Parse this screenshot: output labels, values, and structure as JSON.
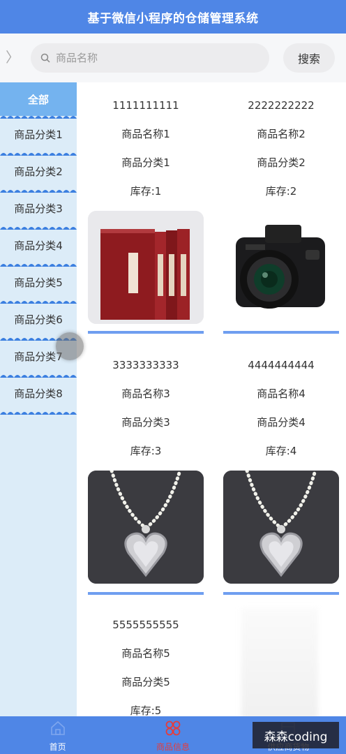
{
  "app": {
    "title": "基于微信小程序的仓储管理系统"
  },
  "search": {
    "placeholder": "商品名称",
    "button_label": "搜索"
  },
  "sidebar": {
    "items": [
      {
        "label": "全部",
        "active": true
      },
      {
        "label": "商品分类1"
      },
      {
        "label": "商品分类2"
      },
      {
        "label": "商品分类3"
      },
      {
        "label": "商品分类4"
      },
      {
        "label": "商品分类5"
      },
      {
        "label": "商品分类6"
      },
      {
        "label": "商品分类7"
      },
      {
        "label": "商品分类8"
      }
    ]
  },
  "products": [
    {
      "code": "1111111111",
      "name": "商品名称1",
      "category": "商品分类1",
      "stock": "库存:1",
      "image": "red-book-set"
    },
    {
      "code": "2222222222",
      "name": "商品名称2",
      "category": "商品分类2",
      "stock": "库存:2",
      "image": "camera"
    },
    {
      "code": "3333333333",
      "name": "商品名称3",
      "category": "商品分类3",
      "stock": "库存:3",
      "image": "heart-necklace"
    },
    {
      "code": "4444444444",
      "name": "商品名称4",
      "category": "商品分类4",
      "stock": "库存:4",
      "image": "heart-necklace"
    },
    {
      "code": "5555555555",
      "name": "商品名称5",
      "category": "商品分类5",
      "stock": "库存:5",
      "image": "none"
    }
  ],
  "tabbar": {
    "items": [
      {
        "label": "首页",
        "icon": "home-icon"
      },
      {
        "label": "商品信息",
        "icon": "goods-icon",
        "active": true
      },
      {
        "label": "供应商货物",
        "icon": "supplier-icon"
      }
    ]
  },
  "watermark": {
    "text": "森森coding"
  },
  "colors": {
    "primary": "#4f86e6",
    "sidebar_bg": "#dcecf8",
    "active_tab": "#e43d3d"
  }
}
